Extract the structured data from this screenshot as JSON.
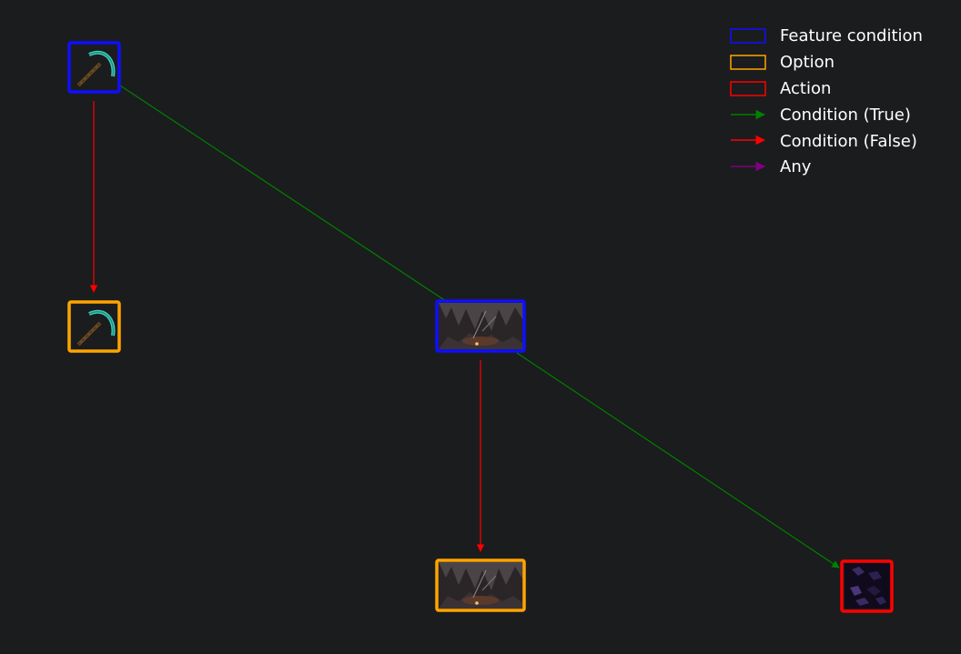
{
  "colors": {
    "background": "#1b1c1e",
    "feature_condition": "#0f0fff",
    "option": "#ffa500",
    "action": "#ff0000",
    "condition_true": "#008000",
    "condition_false": "#ff0000",
    "any": "#800080"
  },
  "legend": {
    "feature_condition": "Feature condition",
    "option": "Option",
    "action": "Action",
    "condition_true": "Condition (True)",
    "condition_false": "Condition (False)",
    "any": "Any"
  },
  "nodes": [
    {
      "id": "pickaxe-condition",
      "kind": "feature_condition",
      "icon": "diamond-pickaxe-icon"
    },
    {
      "id": "pickaxe-option",
      "kind": "option",
      "icon": "diamond-pickaxe-icon"
    },
    {
      "id": "cave-condition",
      "kind": "feature_condition",
      "icon": "cave-scene-icon"
    },
    {
      "id": "cave-option",
      "kind": "option",
      "icon": "cave-scene-icon"
    },
    {
      "id": "obsidian-action",
      "kind": "action",
      "icon": "obsidian-block-icon"
    }
  ],
  "edges": [
    {
      "from": "pickaxe-condition",
      "to": "pickaxe-option",
      "type": "condition_false"
    },
    {
      "from": "pickaxe-condition",
      "to": "cave-condition",
      "type": "condition_true"
    },
    {
      "from": "cave-condition",
      "to": "cave-option",
      "type": "condition_false"
    },
    {
      "from": "cave-condition",
      "to": "obsidian-action",
      "type": "condition_true"
    }
  ]
}
